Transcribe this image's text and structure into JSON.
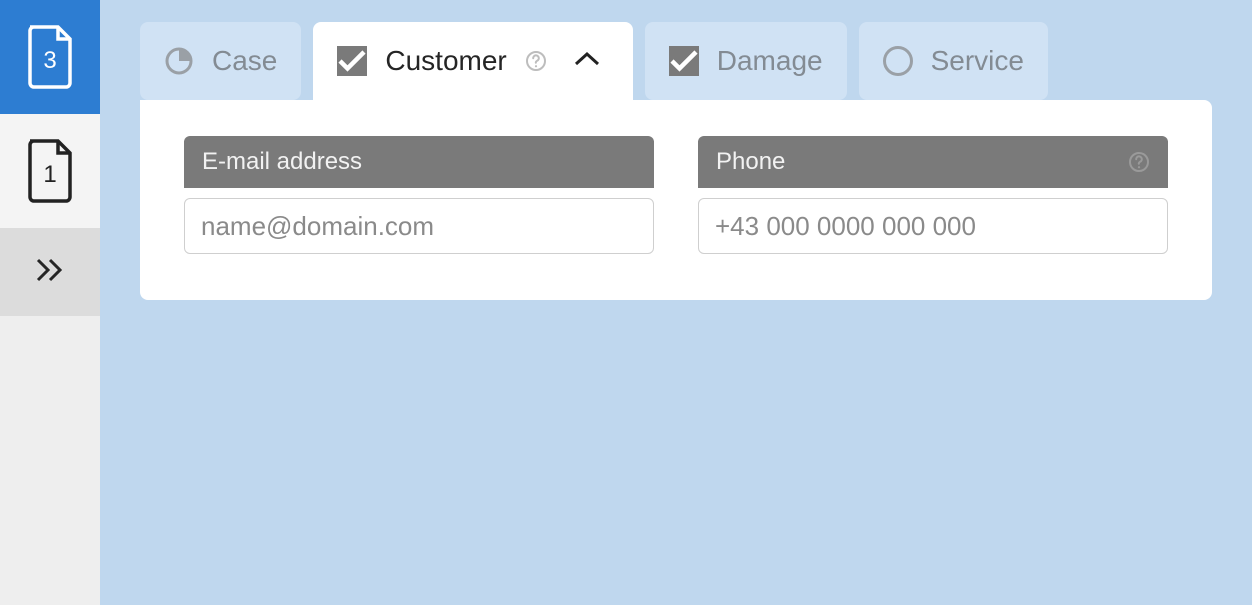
{
  "sidebar": {
    "pages": [
      {
        "badge": "3",
        "active": true
      },
      {
        "badge": "1",
        "active": false
      }
    ]
  },
  "tabs": [
    {
      "key": "case",
      "label": "Case",
      "status": "partial",
      "active": false
    },
    {
      "key": "customer",
      "label": "Customer",
      "status": "checked",
      "active": true,
      "has_help": true,
      "expanded": true
    },
    {
      "key": "damage",
      "label": "Damage",
      "status": "checked",
      "active": false
    },
    {
      "key": "service",
      "label": "Service",
      "status": "empty",
      "active": false
    }
  ],
  "form": {
    "email": {
      "label": "E-mail address",
      "placeholder": "name@domain.com"
    },
    "phone": {
      "label": "Phone",
      "placeholder": "+43 000 0000 000 000",
      "has_help": true
    }
  },
  "colors": {
    "accent": "#2d7dd2"
  }
}
